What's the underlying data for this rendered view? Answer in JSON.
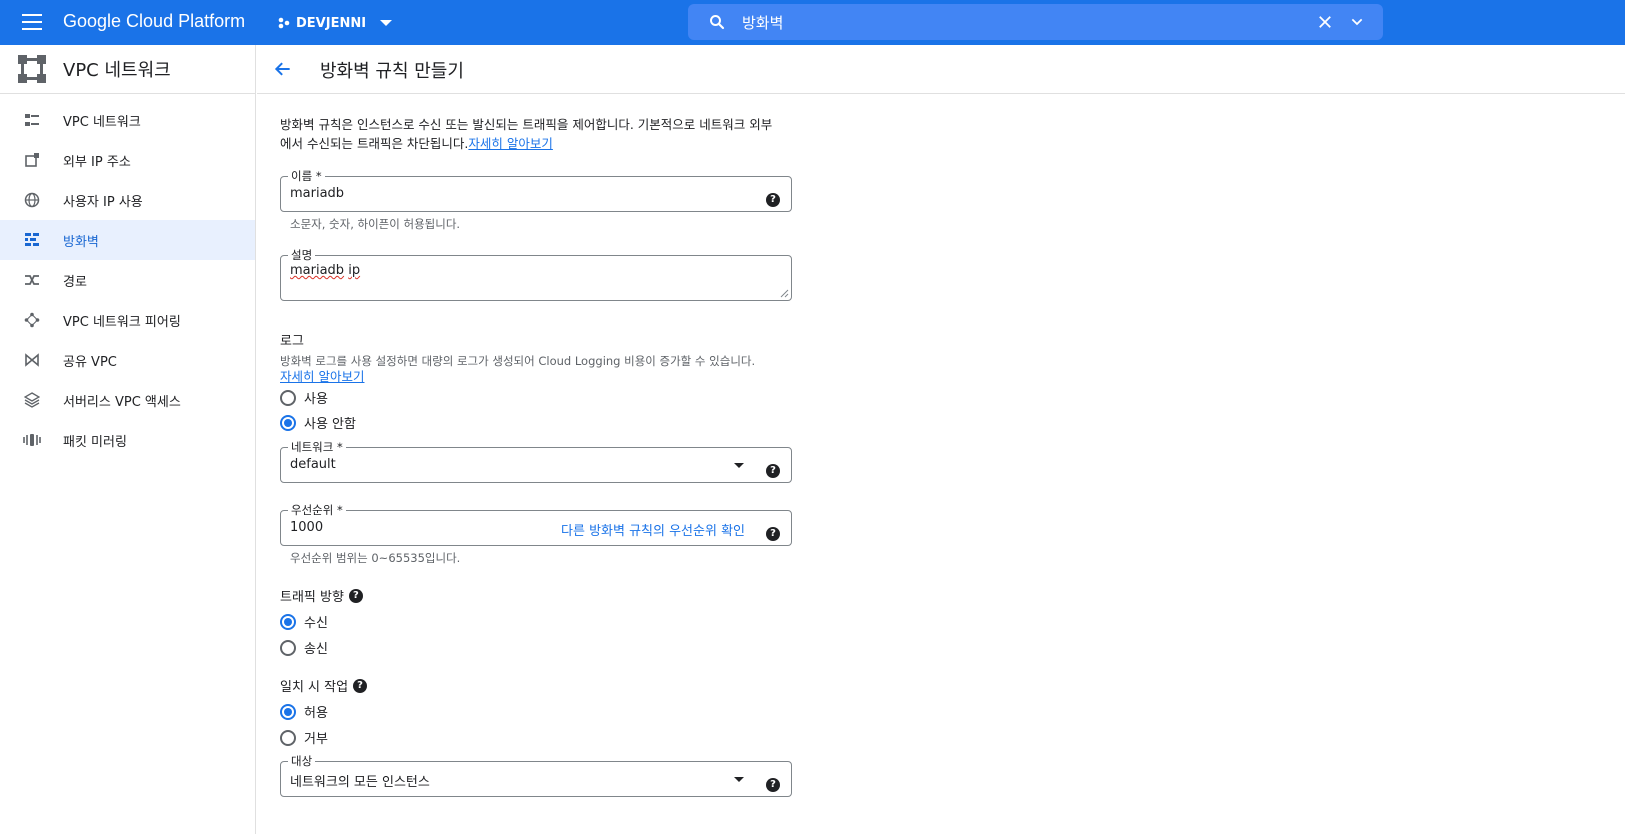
{
  "topbar": {
    "brand": "Google Cloud Platform",
    "project": "DEVJENNI",
    "search_value": "방화벽"
  },
  "sidebar": {
    "title": "VPC 네트워크",
    "items": [
      {
        "label": "VPC 네트워크",
        "icon": "vpc-network-icon"
      },
      {
        "label": "외부 IP 주소",
        "icon": "external-ip-icon"
      },
      {
        "label": "사용자 IP 사용",
        "icon": "globe-icon"
      },
      {
        "label": "방화벽",
        "icon": "firewall-icon",
        "active": true
      },
      {
        "label": "경로",
        "icon": "routes-icon"
      },
      {
        "label": "VPC 네트워크 피어링",
        "icon": "peering-icon"
      },
      {
        "label": "공유 VPC",
        "icon": "shared-vpc-icon"
      },
      {
        "label": "서버리스 VPC 액세스",
        "icon": "serverless-icon"
      },
      {
        "label": "패킷 미러링",
        "icon": "packet-mirroring-icon"
      }
    ]
  },
  "main": {
    "title": "방화벽 규칙 만들기",
    "intro": "방화벽 규칙은 인스턴스로 수신 또는 발신되는 트래픽을 제어합니다. 기본적으로 네트워크 외부에서 수신되는 트래픽은 차단됩니다.",
    "intro_link": "자세히 알아보기",
    "name": {
      "label": "이름 *",
      "value": "mariadb",
      "hint": "소문자, 숫자, 하이픈이 허용됩니다."
    },
    "description": {
      "label": "설명",
      "value_word1": "mariadb",
      "value_word2": "ip"
    },
    "logs": {
      "title": "로그",
      "text": "방화벽 로그를 사용 설정하면 대량의 로그가 생성되어 Cloud Logging 비용이 증가할 수 있습니다.",
      "link": "자세히 알아보기",
      "on": "사용",
      "off": "사용 안함"
    },
    "network": {
      "label": "네트워크 *",
      "value": "default"
    },
    "priority": {
      "label": "우선순위 *",
      "value": "1000",
      "link": "다른 방화벽 규칙의 우선순위 확인",
      "hint": "우선순위 범위는 0~65535입니다."
    },
    "direction": {
      "title": "트래픽 방향",
      "ingress": "수신",
      "egress": "송신"
    },
    "action": {
      "title": "일치 시 작업",
      "allow": "허용",
      "deny": "거부"
    },
    "targets": {
      "label": "대상",
      "value": "네트워크의 모든 인스턴스"
    },
    "help_glyph": "?"
  }
}
